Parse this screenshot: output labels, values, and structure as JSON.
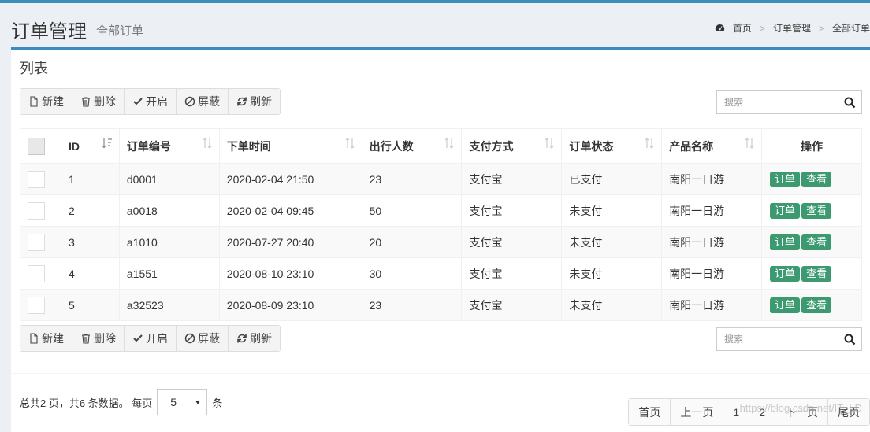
{
  "header": {
    "title": "订单管理",
    "subtitle": "全部订单",
    "breadcrumb": [
      "首页",
      "订单管理",
      "全部订单"
    ]
  },
  "box": {
    "title": "列表"
  },
  "toolbar": {
    "new": "新建",
    "delete": "删除",
    "enable": "开启",
    "block": "屏蔽",
    "refresh": "刷新"
  },
  "search": {
    "placeholder": "搜索"
  },
  "table": {
    "columns": [
      "ID",
      "订单编号",
      "下单时间",
      "出行人数",
      "支付方式",
      "订单状态",
      "产品名称",
      "操作"
    ],
    "rows": [
      {
        "id": "1",
        "order_no": "d0001",
        "time": "2020-02-04 21:50",
        "people": "23",
        "pay": "支付宝",
        "status": "已支付",
        "product": "南阳一日游"
      },
      {
        "id": "2",
        "order_no": "a0018",
        "time": "2020-02-04 09:45",
        "people": "50",
        "pay": "支付宝",
        "status": "未支付",
        "product": "南阳一日游"
      },
      {
        "id": "3",
        "order_no": "a1010",
        "time": "2020-07-27 20:40",
        "people": "20",
        "pay": "支付宝",
        "status": "未支付",
        "product": "南阳一日游"
      },
      {
        "id": "4",
        "order_no": "a1551",
        "time": "2020-08-10 23:10",
        "people": "30",
        "pay": "支付宝",
        "status": "未支付",
        "product": "南阳一日游"
      },
      {
        "id": "5",
        "order_no": "a32523",
        "time": "2020-08-09 23:10",
        "people": "23",
        "pay": "支付宝",
        "status": "未支付",
        "product": "南阳一日游"
      }
    ],
    "op_order": "订单",
    "op_view": "查看"
  },
  "footer": {
    "summary": "总共2 页，共6 条数据。 每页",
    "page_size": "5",
    "unit": "条",
    "pager": [
      "首页",
      "上一页",
      "1",
      "2",
      "下一页",
      "尾页"
    ]
  },
  "watermark": "https://blog.csdn.net/IT_LD",
  "colors": {
    "accent": "#3c8dbc",
    "op_button": "#3d9970"
  }
}
